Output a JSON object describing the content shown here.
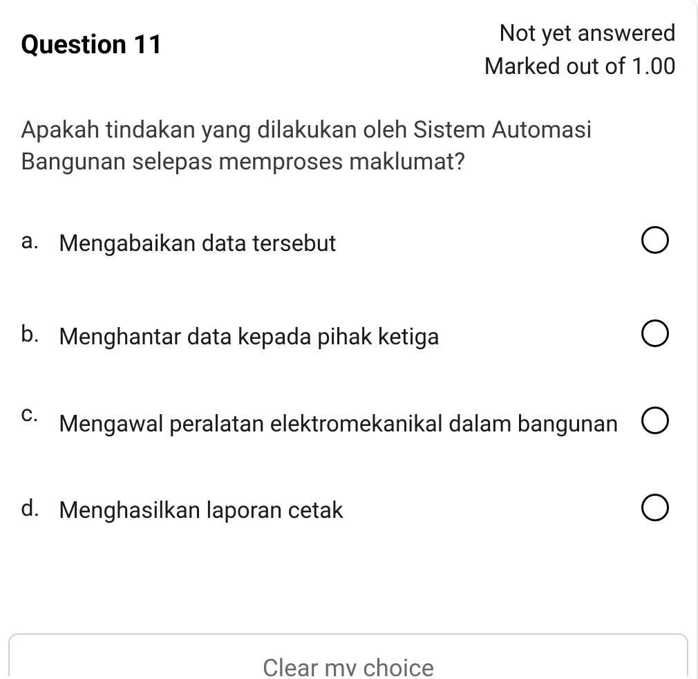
{
  "header": {
    "question_label": "Question 11",
    "status_line1": "Not yet answered",
    "status_line2": "Marked out of 1.00"
  },
  "question": {
    "text": "Apakah tindakan yang dilakukan oleh Sistem Automasi Bangunan selepas memproses maklumat?"
  },
  "options": [
    {
      "letter": "a.",
      "text": "Mengabaikan data tersebut"
    },
    {
      "letter": "b.",
      "text": "Menghantar data kepada pihak ketiga"
    },
    {
      "letter": "c.",
      "text": "Mengawal peralatan elektromekanikal dalam bangunan"
    },
    {
      "letter": "d.",
      "text": "Menghasilkan laporan cetak"
    }
  ],
  "footer": {
    "clear_label": "Clear my choice"
  }
}
